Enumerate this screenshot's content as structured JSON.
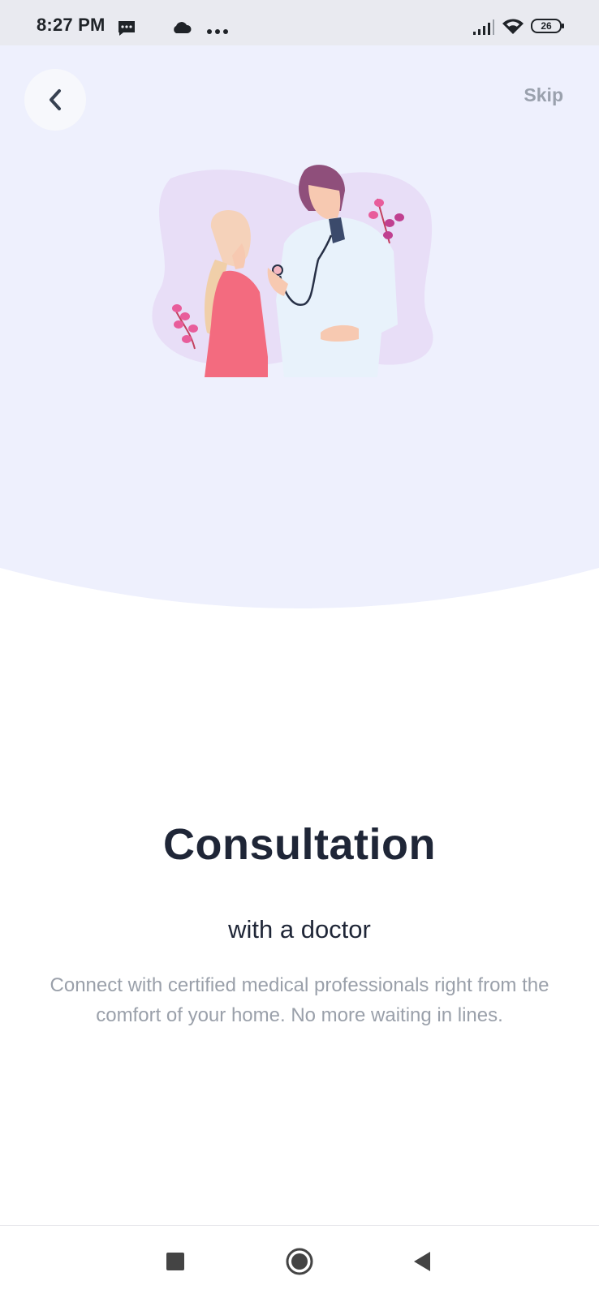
{
  "status_bar": {
    "time": "8:27 PM",
    "battery": "26",
    "icons": [
      "message-icon",
      "cloud-icon",
      "more-dots-icon",
      "signal-icon",
      "wifi-icon",
      "battery-icon"
    ]
  },
  "header": {
    "back_icon": "chevron-left-icon",
    "skip_label": "Skip"
  },
  "onboarding": {
    "title": "Consultation",
    "subtitle": "with a doctor",
    "description": "Connect with certified medical professionals right from the comfort of your home. No more waiting in lines."
  },
  "navigation": {
    "icons": [
      "recent-apps-icon",
      "home-icon",
      "back-icon"
    ]
  },
  "colors": {
    "hero_background": "#eef0fd",
    "title": "#1f2637",
    "muted_text": "#9aa0aa",
    "accent_pink": "#f36b7f"
  }
}
